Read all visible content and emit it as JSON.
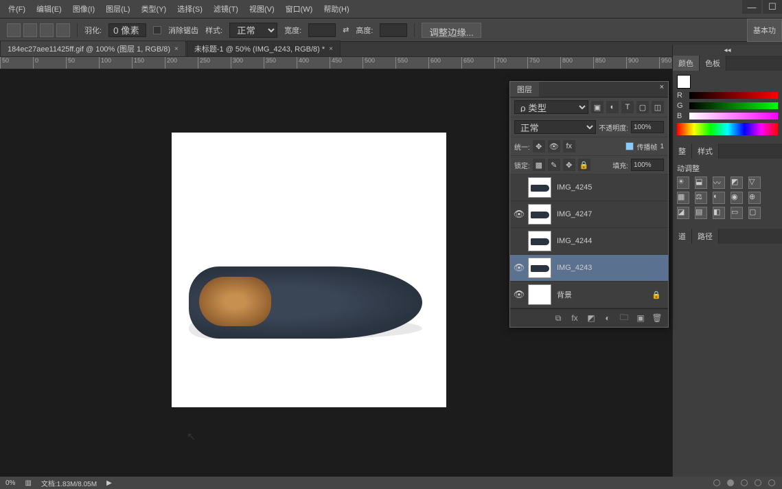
{
  "menu": {
    "file": "件(F)",
    "edit": "编辑(E)",
    "image": "图像(I)",
    "layer": "图层(L)",
    "type": "类型(Y)",
    "select": "选择(S)",
    "filter": "滤镜(T)",
    "view": "视图(V)",
    "window": "窗口(W)",
    "help": "帮助(H)"
  },
  "options": {
    "feather_label": "羽化:",
    "feather_value": "0 像素",
    "antialias": "消除锯齿",
    "style_label": "样式:",
    "style_value": "正常",
    "width_label": "宽度:",
    "height_label": "高度:",
    "refine": "调整边缘...",
    "basic": "基本功"
  },
  "tabs": {
    "tab1": "184ec27aee11425ff.gif @ 100% (图层 1, RGB/8)",
    "tab2": "未标题-1 @ 50% (IMG_4243, RGB/8) *"
  },
  "ruler_ticks": [
    "50",
    "0",
    "50",
    "100",
    "150",
    "200",
    "250",
    "300",
    "350",
    "400",
    "450",
    "500",
    "550",
    "600",
    "650",
    "700",
    "750",
    "800",
    "850",
    "900",
    "950"
  ],
  "status": {
    "zoom": "0%",
    "docsize": "文档:1.83M/8.05M"
  },
  "right": {
    "color_tab": "颜色",
    "swatch_tab": "色板",
    "r": "R",
    "g": "G",
    "b": "B",
    "style_tab": "样式",
    "adjust_label": "动调整",
    "tab_ch": "道",
    "tab_path": "路径"
  },
  "layers": {
    "title": "图层",
    "filter": "ρ 类型",
    "blend": "正常",
    "opacity_label": "不透明度:",
    "opacity_value": "100%",
    "unify_label": "统一:",
    "propagate": "传播帧",
    "propagate_num": "1",
    "lock_label": "锁定:",
    "fill_label": "填充:",
    "fill_value": "100%",
    "items": [
      {
        "name": "IMG_4245",
        "visible": false
      },
      {
        "name": "IMG_4247",
        "visible": true
      },
      {
        "name": "IMG_4244",
        "visible": false
      },
      {
        "name": "IMG_4243",
        "visible": true,
        "selected": true
      },
      {
        "name": "背景",
        "visible": true,
        "locked": true,
        "bg": true
      }
    ]
  }
}
